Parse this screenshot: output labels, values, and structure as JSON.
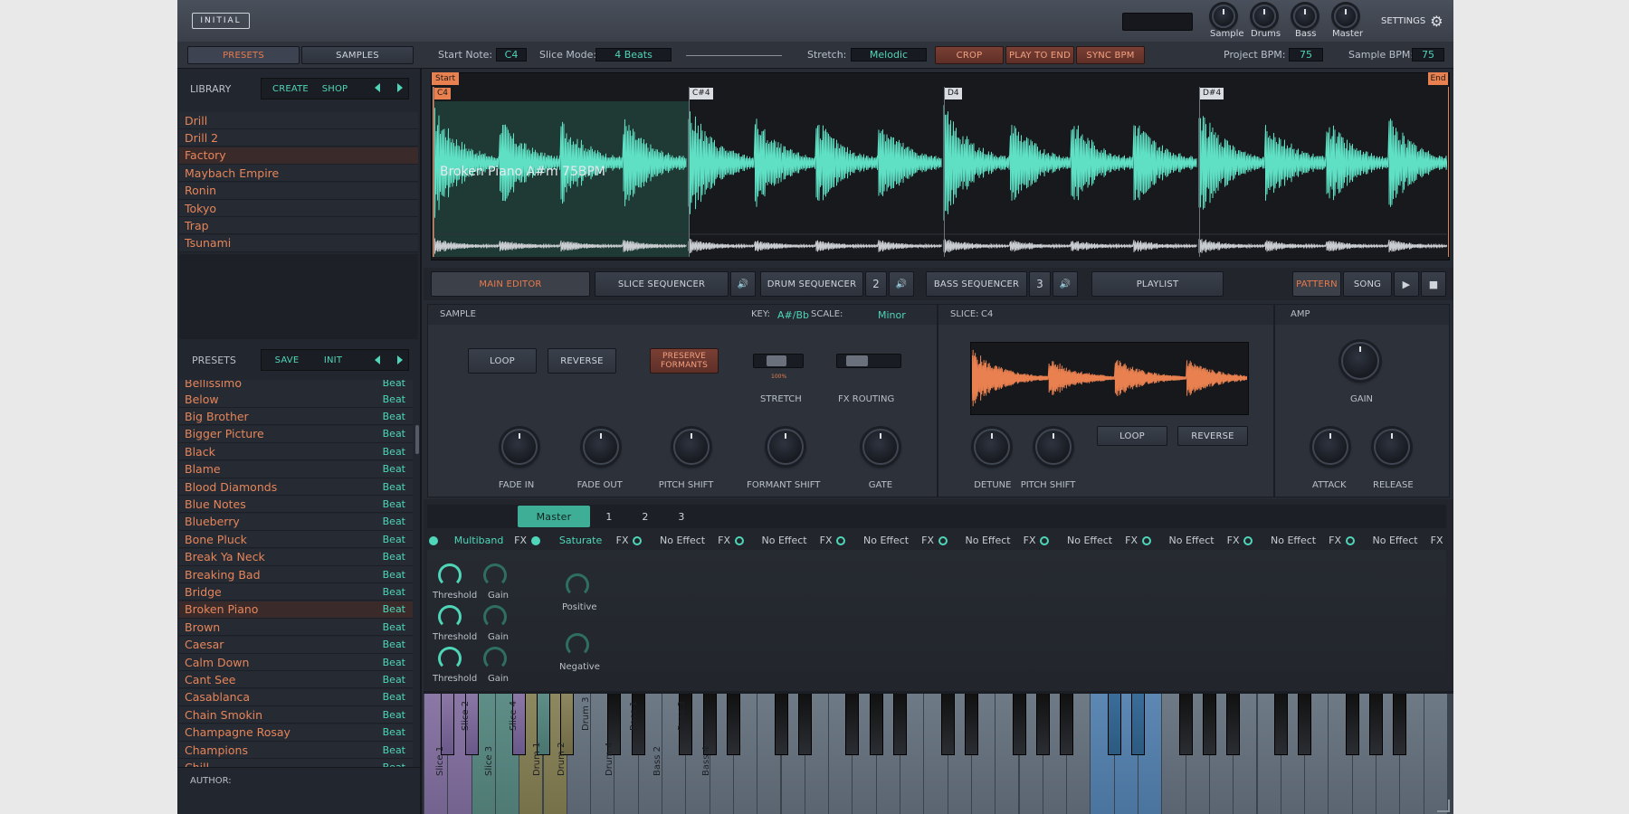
{
  "app": {
    "logo": "INITIAL",
    "settings_label": "SETTINGS"
  },
  "top_knobs": [
    "Sample",
    "Drums",
    "Bass",
    "Master"
  ],
  "tabs": {
    "presets": "PRESETS",
    "samples": "SAMPLES"
  },
  "toolbar": {
    "start_note_label": "Start Note:",
    "start_note_value": "C4",
    "slice_mode_label": "Slice Mode:",
    "slice_mode_value": "4 Beats",
    "stretch_label": "Stretch:",
    "stretch_value": "Melodic",
    "crop": "CROP",
    "play_to_end": "PLAY TO END",
    "sync_bpm": "SYNC BPM",
    "project_bpm_label": "Project BPM:",
    "project_bpm_value": "75",
    "sample_bpm_label": "Sample BPM:",
    "sample_bpm_value": "75"
  },
  "library": {
    "title": "LIBRARY",
    "create": "CREATE",
    "shop": "SHOP",
    "items": [
      "Drill",
      "Drill 2",
      "Factory",
      "Maybach Empire",
      "Ronin",
      "Tokyo",
      "Trap",
      "Tsunami"
    ],
    "selected": "Factory"
  },
  "presets": {
    "title": "PRESETS",
    "save": "SAVE",
    "init": "INIT",
    "partial_top": "Bellissimo",
    "partial_bottom": "Chill",
    "tag": "Beat",
    "items": [
      "Below",
      "Big Brother",
      "Bigger Picture",
      "Black",
      "Blame",
      "Blood Diamonds",
      "Blue Notes",
      "Blueberry",
      "Bone Pluck",
      "Break Ya Neck",
      "Breaking Bad",
      "Bridge",
      "Broken Piano",
      "Brown",
      "Caesar",
      "Calm Down",
      "Cant See",
      "Casablanca",
      "Chain Smokin",
      "Champagne Rosay",
      "Champions"
    ],
    "selected": "Broken Piano"
  },
  "author_label": "AUTHOR:",
  "waveform": {
    "start": "Start",
    "end": "End",
    "sample_name": "Broken Piano A#m 75BPM",
    "markers": [
      "C4",
      "C#4",
      "D4",
      "D#4"
    ]
  },
  "nav": {
    "main_editor": "MAIN EDITOR",
    "slice_sequencer": "SLICE SEQUENCER",
    "drum_sequencer": "DRUM SEQUENCER",
    "drum_num": "2",
    "bass_sequencer": "BASS SEQUENCER",
    "bass_num": "3",
    "playlist": "PLAYLIST",
    "pattern": "PATTERN",
    "song": "SONG"
  },
  "sample_panel": {
    "title": "SAMPLE",
    "key_label": "KEY:",
    "key_value": "A#/Bb",
    "scale_label": "SCALE:",
    "scale_value": "Minor",
    "loop": "LOOP",
    "reverse": "REVERSE",
    "preserve_formants": "PRESERVE FORMANTS",
    "stretch": "STRETCH",
    "stretch_pct": "100%",
    "fx_routing": "FX ROUTING",
    "knobs": [
      "FADE IN",
      "FADE OUT",
      "PITCH SHIFT",
      "FORMANT SHIFT",
      "GATE"
    ]
  },
  "slice_panel": {
    "title_label": "SLICE:",
    "title_value": "C4",
    "loop": "LOOP",
    "reverse": "REVERSE",
    "knobs": [
      "DETUNE",
      "PITCH SHIFT"
    ]
  },
  "amp_panel": {
    "title": "AMP",
    "gain": "GAIN",
    "attack": "ATTACK",
    "release": "RELEASE"
  },
  "fx": {
    "tabs": [
      "Master",
      "1",
      "2",
      "3"
    ],
    "active_tab": "Master",
    "slots": [
      {
        "name": "Multiband",
        "on": true
      },
      {
        "name": "Saturate",
        "on": true
      },
      {
        "name": "No Effect",
        "on": false
      },
      {
        "name": "No Effect",
        "on": false
      },
      {
        "name": "No Effect",
        "on": false
      },
      {
        "name": "No Effect",
        "on": false
      },
      {
        "name": "No Effect",
        "on": false
      },
      {
        "name": "No Effect",
        "on": false
      },
      {
        "name": "No Effect",
        "on": false
      },
      {
        "name": "No Effect",
        "on": false
      }
    ],
    "fx_tag": "FX",
    "threshold": "Threshold",
    "gain": "Gain",
    "positive": "Positive",
    "negative": "Negative"
  },
  "keyboard_labels": {
    "slices": [
      "Slice 1",
      "Slice 2",
      "Slice 3",
      "Slice 4"
    ],
    "drums": [
      "Drum 1",
      "Drum 2",
      "Drum 3",
      "Drum 4"
    ],
    "bass": [
      "Bass 1",
      "Bass 2",
      "Bass 3",
      "Bass 4"
    ]
  },
  "colors": {
    "accent_teal": "#4fd6b8",
    "accent_orange": "#e8804f",
    "bg": "#262a33"
  }
}
